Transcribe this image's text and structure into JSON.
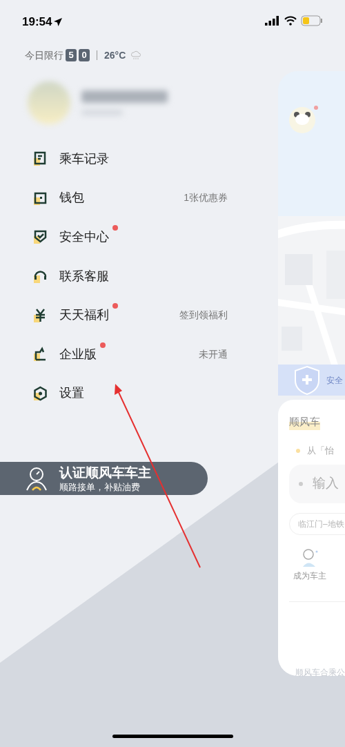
{
  "status_bar": {
    "time": "19:54"
  },
  "restriction": {
    "label": "今日限行",
    "digits": [
      "5",
      "0"
    ],
    "temperature": "26°C"
  },
  "menu": [
    {
      "label": "乘车记录",
      "dot": false
    },
    {
      "label": "钱包",
      "note": "1张优惠券",
      "dot": false
    },
    {
      "label": "安全中心",
      "dot": true
    },
    {
      "label": "联系客服",
      "dot": false
    },
    {
      "label": "天天福利",
      "note": "签到领福利",
      "dot": true
    },
    {
      "label": "企业版",
      "note": "未开通",
      "dot": true
    },
    {
      "label": "设置",
      "dot": false
    }
  ],
  "banner": {
    "title": "认证顺风车车主",
    "subtitle": "顺路接单，补贴油费"
  },
  "home_preview": {
    "avatar_dot": true,
    "safety_label": "安全",
    "section_title": "顺风车",
    "from_hint": "从「怡",
    "destination_placeholder": "输入",
    "station": "临江门–地铁",
    "action": "成为车主",
    "footer": "顺风车合乘公"
  }
}
